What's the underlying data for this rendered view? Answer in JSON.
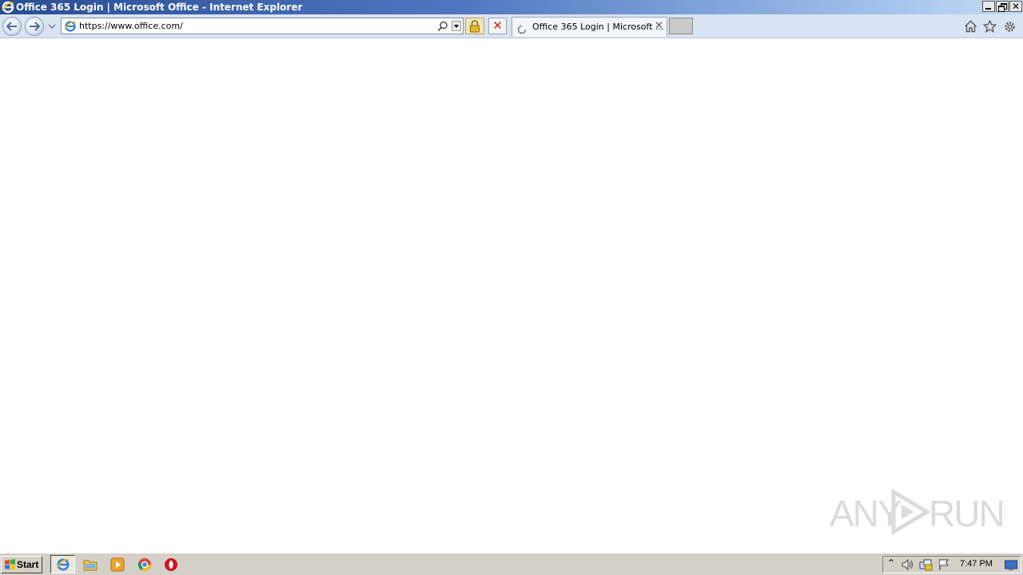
{
  "window": {
    "title": "Office 365 Login | Microsoft Office - Internet Explorer"
  },
  "toolbar": {
    "url": "https://www.office.com/",
    "tab_label": "Office 365 Login | Microsoft ..."
  },
  "watermark": {
    "left": "ANY",
    "right": "RUN"
  },
  "taskbar": {
    "start_label": "Start",
    "clock": "7:47 PM"
  },
  "colors": {
    "titlebar_start": "#2a4e96",
    "titlebar_end": "#c6dcf6",
    "toolbar_bg": "#d9e4f2",
    "taskbar_bg": "#d4d0c8"
  }
}
